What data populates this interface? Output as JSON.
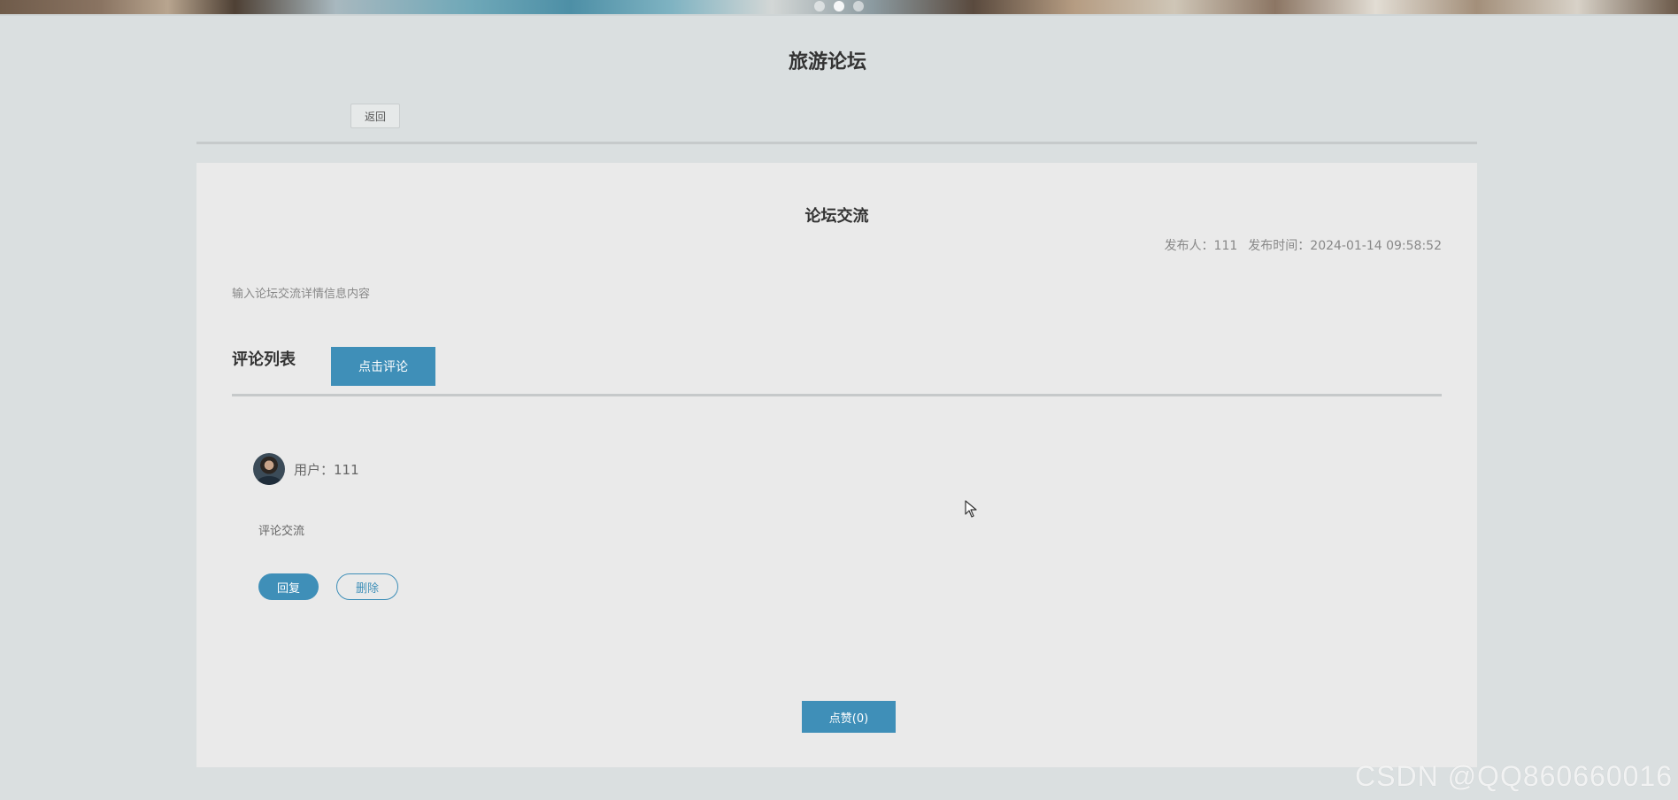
{
  "page": {
    "site_title": "旅游论坛",
    "back_label": "返回"
  },
  "post": {
    "title": "论坛交流",
    "author_label": "发布人：111",
    "time_label": "发布时间：2024-01-14 09:58:52",
    "content": "输入论坛交流详情信息内容",
    "like_label": "点赞(0)"
  },
  "comments": {
    "header": "评论列表",
    "add_label": "点击评论",
    "items": [
      {
        "user_label": "用户：111",
        "text": "评论交流",
        "reply_label": "回复",
        "delete_label": "删除"
      }
    ]
  },
  "watermark": "CSDN @QQ860660016",
  "colors": {
    "accent": "#3f8fb8",
    "page_bg": "#dadfe0",
    "card_bg": "#eaeaea"
  },
  "icons": {
    "avatar": "user-avatar",
    "cursor": "mouse-pointer-icon"
  }
}
